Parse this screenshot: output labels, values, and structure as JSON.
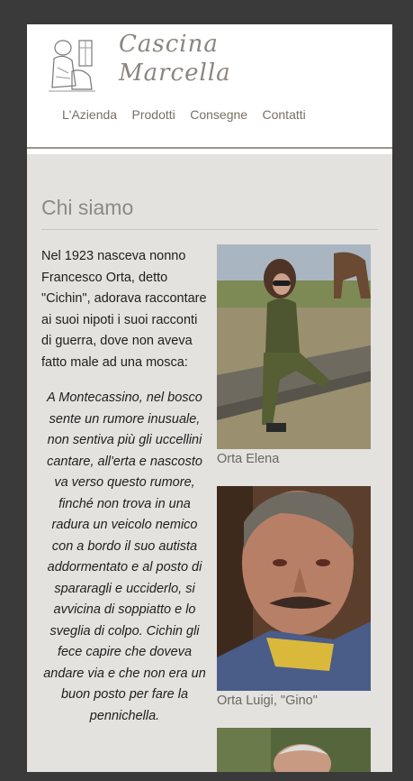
{
  "brand": {
    "line1": "Cascina",
    "line2": "Marcella"
  },
  "nav": [
    {
      "label": "L'Azienda"
    },
    {
      "label": "Prodotti"
    },
    {
      "label": "Consegne"
    },
    {
      "label": "Contatti"
    }
  ],
  "section": {
    "title": "Chi siamo"
  },
  "story": {
    "intro": "Nel 1923 nasceva nonno Francesco Orta, detto \"Cichin\", adorava raccontare ai suoi nipoti i suoi racconti di guerra, dove non aveva fatto male ad una mosca:",
    "quote": "A Montecassino, nel bosco sente un rumore inusuale, non sentiva più gli uccellini cantare, all'erta e nascosto va verso questo rumore, finché non trova in una radura un veicolo nemico con a bordo il suo autista addormentato e al posto di spararagli e ucciderlo, si avvicina di soppiatto e lo sveglia di colpo. Cichin gli fece capire che doveva andare via e che non era un buon posto per fare la pennichella."
  },
  "photos": [
    {
      "caption": "Orta Elena"
    },
    {
      "caption": "Orta Luigi, \"Gino\""
    }
  ]
}
